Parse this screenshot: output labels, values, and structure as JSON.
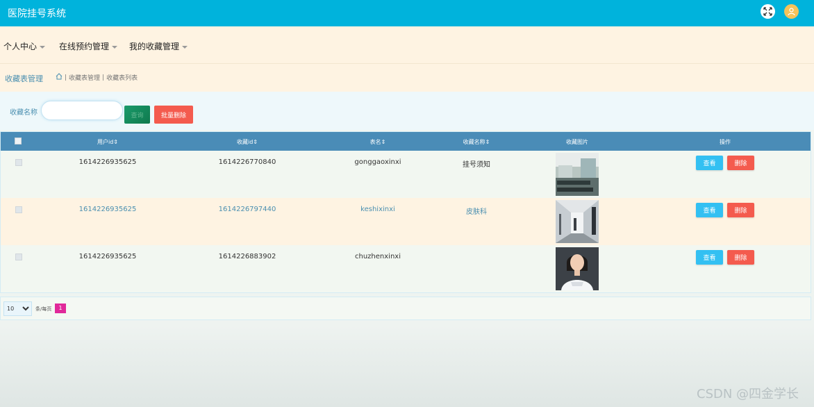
{
  "app": {
    "title": "医院挂号系统"
  },
  "colors": {
    "header": "#00b3dc",
    "accent": "#4a8cb7",
    "danger": "#f45b4e",
    "info": "#33c0f2",
    "page_active": "#e0299a"
  },
  "header_icons": {
    "fullscreen": "fullscreen-icon",
    "user": "user-avatar-icon"
  },
  "nav": {
    "items": [
      {
        "label": "个人中心"
      },
      {
        "label": "在线预约管理"
      },
      {
        "label": "我的收藏管理"
      }
    ]
  },
  "breadcrumb": {
    "title": "收藏表管理",
    "home_icon": "home-icon",
    "path": [
      "收藏表管理",
      "收藏表列表"
    ]
  },
  "search": {
    "label": "收藏名称",
    "value": "",
    "placeholder": "",
    "search_label": "查询",
    "batch_delete_label": "批量删除"
  },
  "table": {
    "columns": [
      "用户id",
      "收藏id",
      "表名",
      "收藏名称",
      "收藏图片",
      "操作"
    ],
    "rows": [
      {
        "user_id": "1614226935625",
        "fav_id": "1614226770840",
        "table_name": "gonggaoxinxi",
        "fav_name": "挂号须知",
        "image": "hospital-hallway-photo"
      },
      {
        "user_id": "1614226935625",
        "fav_id": "1614226797440",
        "table_name": "keshixinxi",
        "fav_name": "皮肤科",
        "image": "corridor-photo"
      },
      {
        "user_id": "1614226935625",
        "fav_id": "1614226883902",
        "table_name": "chuzhenxinxi",
        "fav_name": "",
        "image": "doctor-portrait-photo"
      }
    ],
    "view_label": "查看",
    "delete_label": "删除"
  },
  "pagination": {
    "page_size": "10",
    "page_size_options": [
      "10"
    ],
    "per_page_label": "条/每页",
    "current_page": "1"
  },
  "watermark": "CSDN @四金学长"
}
